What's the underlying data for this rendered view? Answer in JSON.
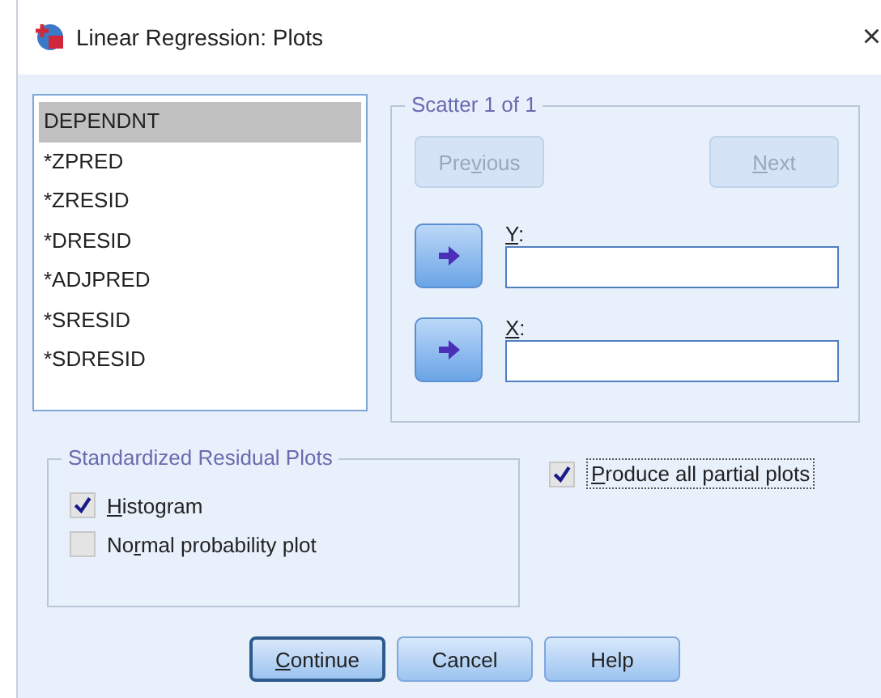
{
  "window": {
    "title": "Linear Regression: Plots",
    "close": "×"
  },
  "variables": [
    {
      "label": "DEPENDNT",
      "selected": true
    },
    {
      "label": "*ZPRED",
      "selected": false
    },
    {
      "label": "*ZRESID",
      "selected": false
    },
    {
      "label": "*DRESID",
      "selected": false
    },
    {
      "label": "*ADJPRED",
      "selected": false
    },
    {
      "label": "*SRESID",
      "selected": false
    },
    {
      "label": "*SDRESID",
      "selected": false
    }
  ],
  "scatter": {
    "title": "Scatter 1 of 1",
    "nav": [
      {
        "before": "Pre",
        "key": "v",
        "after": "ious",
        "disabled": true
      },
      {
        "key": "N",
        "after": "ext",
        "disabled": true
      }
    ],
    "axes": [
      {
        "key": "Y",
        "after": ":"
      },
      {
        "key": "X",
        "after": ":"
      }
    ]
  },
  "residual_plots": {
    "title": "Standardized Residual Plots",
    "options": [
      {
        "key": "H",
        "after": "istogram",
        "checked": true
      },
      {
        "before": "No",
        "key": "r",
        "after": "mal probability plot",
        "checked": false
      }
    ]
  },
  "partial_plots": {
    "key": "P",
    "after": "roduce all partial plots",
    "checked": true
  },
  "buttons": [
    {
      "key": "C",
      "after": "ontinue",
      "default": true
    },
    {
      "after": "Cancel",
      "default": false
    },
    {
      "after": "Help",
      "default": false
    }
  ]
}
